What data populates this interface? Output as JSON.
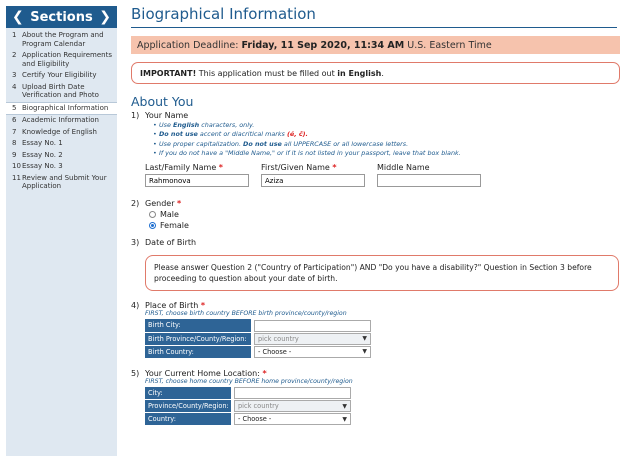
{
  "sidebar": {
    "title": "Sections",
    "items": [
      {
        "num": "1",
        "label": "About the Program and Program Calendar"
      },
      {
        "num": "2",
        "label": "Application Requirements and Eligibility"
      },
      {
        "num": "3",
        "label": "Certify Your Eligibility"
      },
      {
        "num": "4",
        "label": "Upload Birth Date Verification and Photo"
      },
      {
        "num": "5",
        "label": "Biographical Information"
      },
      {
        "num": "6",
        "label": "Academic Information"
      },
      {
        "num": "7",
        "label": "Knowledge of English"
      },
      {
        "num": "8",
        "label": "Essay No. 1"
      },
      {
        "num": "9",
        "label": "Essay No. 2"
      },
      {
        "num": "10",
        "label": "Essay No. 3"
      },
      {
        "num": "11",
        "label": "Review and Submit Your Application"
      }
    ],
    "active_index": 4
  },
  "page": {
    "title": "Biographical Information",
    "deadline_prefix": "Application Deadline:",
    "deadline_value": "Friday, 11 Sep 2020, 11:34 AM",
    "deadline_suffix": "U.S. Eastern Time",
    "important_label": "IMPORTANT!",
    "important_text": "This application must be filled out",
    "important_lang": "in English",
    "important_end": "."
  },
  "about": {
    "title": "About You",
    "q1": {
      "num": "1)",
      "label": "Your Name",
      "tip1_a": "Use",
      "tip1_b": "English",
      "tip1_c": "characters, only.",
      "tip2_a": "Do not use",
      "tip2_b": "accent or diacritical marks",
      "tip2_c": "(é, č).",
      "tip3_a": "Use proper capitalization.",
      "tip3_b": "Do not use",
      "tip3_c": "all UPPERCASE or all lowercase letters.",
      "tip4": "If you do not have a \"Middle Name,\" or if it is not listed in your passport, leave that box blank.",
      "last_label": "Last/Family Name",
      "last_value": "Rahmonova",
      "first_label": "First/Given Name",
      "first_value": "Aziza",
      "middle_label": "Middle Name",
      "middle_value": ""
    },
    "q2": {
      "num": "2)",
      "label": "Gender",
      "options": [
        "Male",
        "Female"
      ],
      "selected": "Female"
    },
    "q3": {
      "num": "3)",
      "label": "Date of Birth",
      "notice": "Please answer Question 2 (\"Country of Participation\") AND \"Do you have a disability?\" Question in Section 3 before proceeding to question about your date of birth."
    },
    "q4": {
      "num": "4)",
      "label": "Place of Birth",
      "hint": "FIRST, choose birth country BEFORE birth province/county/region",
      "city_label": "Birth City:",
      "city_value": "",
      "province_label": "Birth Province/County/Region:",
      "province_value": "pick country",
      "country_label": "Birth Country:",
      "country_value": "- Choose -"
    },
    "q5": {
      "num": "5)",
      "label": "Your Current Home Location:",
      "hint": "FIRST, choose home country BEFORE home province/county/region",
      "city_label": "City:",
      "city_value": "",
      "province_label": "Province/County/Region:",
      "province_value": "pick country",
      "country_label": "Country:",
      "country_value": "- Choose -"
    },
    "required_mark": "*"
  }
}
